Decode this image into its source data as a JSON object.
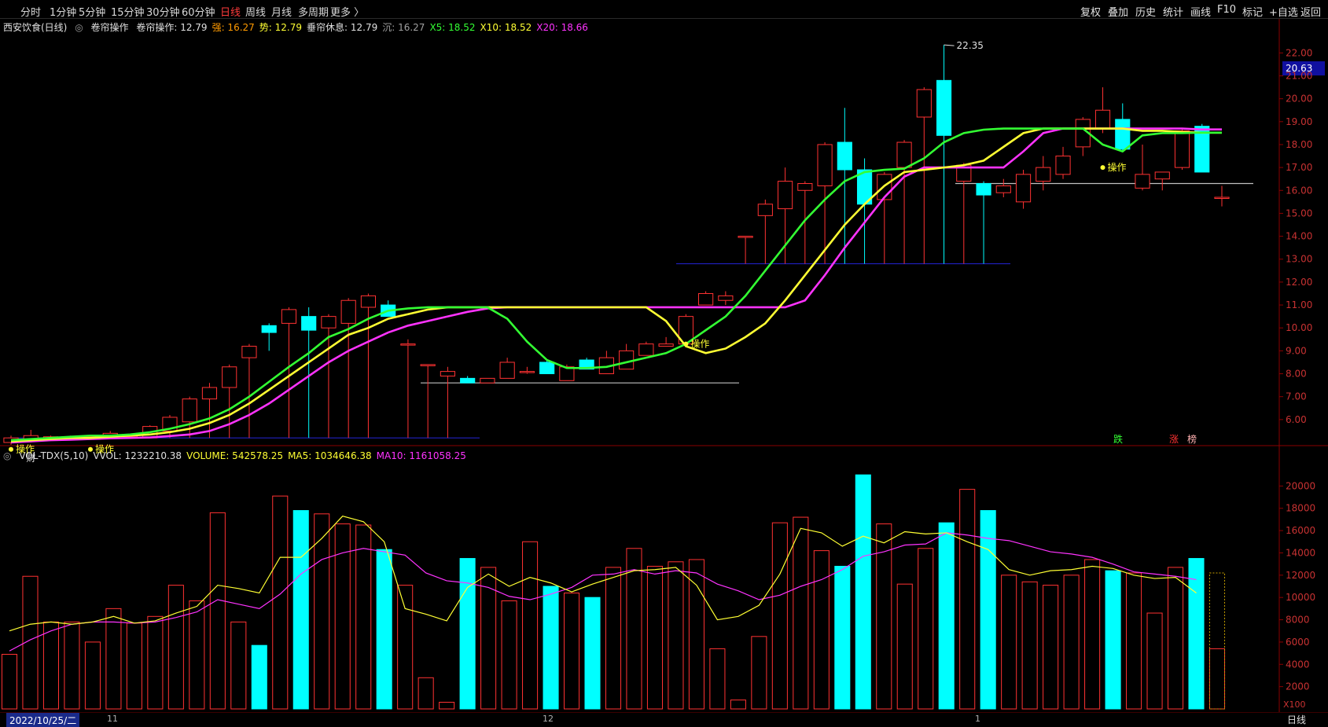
{
  "toolbar": {
    "left": [
      "分时",
      "1分钟",
      "5分钟",
      "15分钟",
      "30分钟",
      "60分钟",
      "日线",
      "周线",
      "月线",
      "多周期",
      "更多 〉"
    ],
    "active": "日线",
    "right": [
      "复权",
      "叠加",
      "历史",
      "统计",
      "画线",
      "F10",
      "标记",
      "+自选",
      "返回"
    ]
  },
  "indicator_bar": {
    "stock": "西安饮食(日线)",
    "indicator_icon": "circle-icon",
    "name": "卷帘操作",
    "items": [
      {
        "label": "卷帘操作: 12.79",
        "color": "#e0e0e0"
      },
      {
        "label": "强: 16.27",
        "color": "#ff9a00"
      },
      {
        "label": "势: 12.79",
        "color": "#ffff33"
      },
      {
        "label": "垂帘休息: 12.79",
        "color": "#e0e0e0"
      },
      {
        "label": "沉: 16.27",
        "color": "#a0a0a0"
      },
      {
        "label": "X5: 18.52",
        "color": "#33ff33"
      },
      {
        "label": "X10: 18.52",
        "color": "#ffff33"
      },
      {
        "label": "X20: 18.66",
        "color": "#ff33ff"
      }
    ]
  },
  "volume_bar": {
    "indicator_icon": "circle-icon",
    "items": [
      {
        "label": "VOL-TDX(5,10)",
        "color": "#e0e0e0"
      },
      {
        "label": "VVOL: 1232210.38",
        "color": "#e0e0e0"
      },
      {
        "label": "VOLUME: 542578.25",
        "color": "#ffff33"
      },
      {
        "label": "MA5: 1034646.38",
        "color": "#ffff33"
      },
      {
        "label": "MA10: 1161058.25",
        "color": "#ff33ff"
      }
    ]
  },
  "current_price": "20.63",
  "high_label": "22.35",
  "annotations": {
    "op": "操作",
    "cai": "财",
    "die": "跌",
    "zhang": "涨",
    "bang": "榜"
  },
  "bottom": {
    "date": "2022/10/25/二",
    "months": [
      "11",
      "12",
      "1"
    ],
    "period": "日线",
    "unit": "X100"
  },
  "colors": {
    "up": "#ff3232",
    "down": "#00ffff",
    "x5": "#33ff33",
    "x10": "#ffff33",
    "x20": "#ff33ff",
    "axis": "#8a0000"
  },
  "chart_data": [
    {
      "type": "candlestick",
      "title": "西安饮食(日线)",
      "ylim": [
        5.0,
        22.8
      ],
      "yticks": [
        "6.00",
        "7.00",
        "8.00",
        "9.00",
        "10.00",
        "11.00",
        "12.00",
        "13.00",
        "14.00",
        "15.00",
        "16.00",
        "17.00",
        "18.00",
        "19.00",
        "20.00",
        "21.00",
        "22.00"
      ],
      "candles": [
        {
          "o": 5.0,
          "c": 5.2,
          "h": 5.3,
          "l": 4.9
        },
        {
          "o": 5.15,
          "c": 5.3,
          "h": 5.55,
          "l": 5.0
        },
        {
          "o": 5.2,
          "c": 5.25,
          "h": 5.3,
          "l": 5.15
        },
        {
          "o": 5.2,
          "c": 5.25,
          "h": 5.3,
          "l": 5.1
        },
        {
          "o": 5.2,
          "c": 5.25,
          "h": 5.3,
          "l": 5.15
        },
        {
          "o": 5.2,
          "c": 5.4,
          "h": 5.5,
          "l": 5.2
        },
        {
          "o": 5.25,
          "c": 5.3,
          "h": 5.35,
          "l": 5.2
        },
        {
          "o": 5.2,
          "c": 5.7,
          "h": 5.75,
          "l": 5.2
        },
        {
          "o": 5.5,
          "c": 6.1,
          "h": 6.2,
          "l": 5.2
        },
        {
          "o": 5.9,
          "c": 6.9,
          "h": 7.0,
          "l": 5.2
        },
        {
          "o": 6.9,
          "c": 7.4,
          "h": 7.6,
          "l": 5.2
        },
        {
          "o": 7.4,
          "c": 8.3,
          "h": 8.4,
          "l": 5.2
        },
        {
          "o": 8.7,
          "c": 9.2,
          "h": 9.3,
          "l": 5.2
        },
        {
          "o": 10.1,
          "c": 9.8,
          "h": 10.2,
          "l": 9.0
        },
        {
          "o": 10.2,
          "c": 10.8,
          "h": 10.9,
          "l": 5.2
        },
        {
          "o": 10.5,
          "c": 9.9,
          "h": 10.9,
          "l": 5.2
        },
        {
          "o": 10.0,
          "c": 10.5,
          "h": 10.6,
          "l": 5.2
        },
        {
          "o": 10.2,
          "c": 11.2,
          "h": 11.3,
          "l": 5.2
        },
        {
          "o": 10.9,
          "c": 11.4,
          "h": 11.5,
          "l": 5.2
        },
        {
          "o": 11.0,
          "c": 10.5,
          "h": 11.2,
          "l": 10.5
        },
        {
          "o": 9.3,
          "c": 9.3,
          "h": 9.5,
          "l": 5.2
        },
        {
          "o": 8.4,
          "c": 8.4,
          "h": 8.4,
          "l": 5.2
        },
        {
          "o": 7.9,
          "c": 8.1,
          "h": 8.3,
          "l": 5.2
        },
        {
          "o": 7.8,
          "c": 7.6,
          "h": 7.9,
          "l": 7.6
        },
        {
          "o": 7.6,
          "c": 7.8,
          "h": 7.8,
          "l": 7.6
        },
        {
          "o": 7.8,
          "c": 8.5,
          "h": 8.7,
          "l": 7.8
        },
        {
          "o": 8.1,
          "c": 8.1,
          "h": 8.3,
          "l": 8.0
        },
        {
          "o": 8.5,
          "c": 8.0,
          "h": 8.6,
          "l": 8.0
        },
        {
          "o": 7.7,
          "c": 8.3,
          "h": 8.4,
          "l": 7.7
        },
        {
          "o": 8.6,
          "c": 8.2,
          "h": 8.7,
          "l": 8.2
        },
        {
          "o": 8.0,
          "c": 8.7,
          "h": 9.0,
          "l": 8.0
        },
        {
          "o": 8.2,
          "c": 9.0,
          "h": 9.3,
          "l": 8.2
        },
        {
          "o": 8.8,
          "c": 9.3,
          "h": 9.4,
          "l": 8.8
        },
        {
          "o": 9.2,
          "c": 9.3,
          "h": 9.6,
          "l": 9.2
        },
        {
          "o": 9.3,
          "c": 10.5,
          "h": 10.6,
          "l": 9.3
        },
        {
          "o": 11.0,
          "c": 11.5,
          "h": 11.6,
          "l": 11.0
        },
        {
          "o": 11.2,
          "c": 11.4,
          "h": 11.6,
          "l": 11.0
        },
        {
          "o": 14.0,
          "c": 14.0,
          "h": 14.0,
          "l": 12.8
        },
        {
          "o": 14.9,
          "c": 15.4,
          "h": 15.6,
          "l": 12.8
        },
        {
          "o": 15.2,
          "c": 16.4,
          "h": 17.0,
          "l": 12.8
        },
        {
          "o": 16.0,
          "c": 16.3,
          "h": 16.4,
          "l": 12.8
        },
        {
          "o": 16.2,
          "c": 18.0,
          "h": 18.1,
          "l": 12.8
        },
        {
          "o": 18.1,
          "c": 16.9,
          "h": 19.6,
          "l": 12.8
        },
        {
          "o": 16.9,
          "c": 15.4,
          "h": 17.4,
          "l": 12.8
        },
        {
          "o": 15.6,
          "c": 16.7,
          "h": 16.8,
          "l": 12.8
        },
        {
          "o": 17.0,
          "c": 18.1,
          "h": 18.2,
          "l": 12.8
        },
        {
          "o": 19.2,
          "c": 20.4,
          "h": 20.5,
          "l": 12.8
        },
        {
          "o": 20.8,
          "c": 18.4,
          "h": 22.35,
          "l": 12.8
        },
        {
          "o": 16.4,
          "c": 17.1,
          "h": 17.2,
          "l": 12.8
        },
        {
          "o": 16.3,
          "c": 15.8,
          "h": 16.4,
          "l": 12.8
        },
        {
          "o": 15.9,
          "c": 16.2,
          "h": 16.5,
          "l": 15.7
        },
        {
          "o": 15.5,
          "c": 16.7,
          "h": 16.9,
          "l": 15.2
        },
        {
          "o": 16.4,
          "c": 17.0,
          "h": 17.5,
          "l": 16.0
        },
        {
          "o": 16.7,
          "c": 17.5,
          "h": 17.9,
          "l": 16.5
        },
        {
          "o": 17.9,
          "c": 19.1,
          "h": 19.2,
          "l": 17.5
        },
        {
          "o": 18.7,
          "c": 19.5,
          "h": 20.5,
          "l": 18.5
        },
        {
          "o": 19.1,
          "c": 17.8,
          "h": 19.8,
          "l": 17.7
        },
        {
          "o": 16.1,
          "c": 16.7,
          "h": 18.0,
          "l": 16.0
        },
        {
          "o": 16.5,
          "c": 16.8,
          "h": 16.8,
          "l": 16.0
        },
        {
          "o": 17.0,
          "c": 18.6,
          "h": 18.7,
          "l": 16.9
        },
        {
          "o": 18.8,
          "c": 16.8,
          "h": 18.9,
          "l": 16.8
        },
        {
          "o": 15.7,
          "c": 15.7,
          "h": 16.2,
          "l": 15.3
        }
      ],
      "x5": [
        5.1,
        5.15,
        5.2,
        5.25,
        5.3,
        5.3,
        5.35,
        5.45,
        5.6,
        5.8,
        6.05,
        6.45,
        7.0,
        7.65,
        8.3,
        8.9,
        9.6,
        9.95,
        10.4,
        10.75,
        10.85,
        10.9,
        10.9,
        10.9,
        10.9,
        10.4,
        9.4,
        8.6,
        8.25,
        8.25,
        8.3,
        8.5,
        8.7,
        8.9,
        9.3,
        9.9,
        10.5,
        11.4,
        12.5,
        13.6,
        14.7,
        15.6,
        16.4,
        16.8,
        16.9,
        16.95,
        17.4,
        18.1,
        18.5,
        18.65,
        18.7,
        18.7,
        18.7,
        18.7,
        18.7,
        18.0,
        17.7,
        18.4,
        18.5,
        18.5,
        18.52,
        18.52
      ],
      "x10": [
        5.05,
        5.1,
        5.15,
        5.2,
        5.2,
        5.25,
        5.3,
        5.35,
        5.45,
        5.6,
        5.85,
        6.2,
        6.7,
        7.3,
        7.9,
        8.5,
        9.1,
        9.7,
        10.0,
        10.4,
        10.6,
        10.8,
        10.9,
        10.9,
        10.9,
        10.9,
        10.9,
        10.9,
        10.9,
        10.9,
        10.9,
        10.9,
        10.9,
        10.3,
        9.2,
        8.9,
        9.1,
        9.6,
        10.2,
        11.2,
        12.3,
        13.4,
        14.5,
        15.4,
        16.2,
        16.8,
        16.9,
        17.0,
        17.1,
        17.3,
        17.9,
        18.5,
        18.7,
        18.7,
        18.7,
        18.7,
        18.7,
        18.6,
        18.6,
        18.55,
        18.52,
        18.52
      ],
      "x20": [
        5.0,
        5.05,
        5.1,
        5.12,
        5.15,
        5.18,
        5.2,
        5.22,
        5.28,
        5.35,
        5.5,
        5.8,
        6.2,
        6.7,
        7.3,
        7.9,
        8.5,
        9.0,
        9.4,
        9.8,
        10.1,
        10.3,
        10.5,
        10.7,
        10.85,
        10.9,
        10.9,
        10.9,
        10.9,
        10.9,
        10.9,
        10.9,
        10.9,
        10.9,
        10.9,
        10.9,
        10.9,
        10.9,
        10.9,
        10.9,
        11.2,
        12.3,
        13.5,
        14.6,
        15.7,
        16.6,
        17.0,
        17.0,
        17.0,
        17.0,
        17.0,
        17.7,
        18.5,
        18.7,
        18.7,
        18.7,
        18.7,
        18.7,
        18.7,
        18.7,
        18.66,
        18.66
      ],
      "levels": [
        {
          "y": 16.3,
          "color": "#c0c0c0"
        },
        {
          "y": 7.6,
          "color": "#c0c0c0"
        },
        {
          "y": 12.8,
          "color": "#2020c0"
        },
        {
          "y": 5.2,
          "color": "#2020c0"
        }
      ]
    },
    {
      "type": "bar",
      "title": "VOL-TDX(5,10)",
      "ylim": [
        0,
        22000
      ],
      "yticks": [
        "2000",
        "4000",
        "6000",
        "8000",
        "10000",
        "12000",
        "14000",
        "16000",
        "18000",
        "20000"
      ],
      "volumes": [
        4900,
        11900,
        7800,
        7800,
        6000,
        9000,
        7700,
        8300,
        11100,
        9700,
        17600,
        7800,
        5700,
        19100,
        17800,
        17500,
        16600,
        16500,
        14300,
        11100,
        2800,
        600,
        13500,
        12700,
        9700,
        15000,
        11000,
        10400,
        10000,
        12700,
        14400,
        12800,
        13200,
        13400,
        5400,
        800,
        6500,
        16700,
        17200,
        14200,
        12800,
        21000,
        16600,
        11200,
        14400,
        16700,
        19700,
        17800,
        12000,
        11400,
        11100,
        12000,
        13400,
        12400,
        12200,
        8600,
        12700,
        13500,
        5400
      ],
      "ma5": [
        7000,
        7600,
        7800,
        7600,
        7800,
        8300,
        7700,
        7900,
        8600,
        9200,
        11100,
        10800,
        10400,
        13600,
        13600,
        15300,
        17300,
        16800,
        15000,
        9000,
        8500,
        7900,
        10900,
        12100,
        11000,
        11800,
        11300,
        10500,
        11200,
        11800,
        12400,
        12500,
        12700,
        11100,
        8000,
        8300,
        9300,
        12100,
        16200,
        15800,
        14600,
        15500,
        14900,
        15900,
        15700,
        15800,
        15000,
        14300,
        12500,
        12000,
        12400,
        12500,
        12800,
        12600,
        12000,
        11700,
        11800,
        10400
      ],
      "ma10": [
        5200,
        6200,
        7000,
        7600,
        7800,
        7800,
        7700,
        7800,
        8200,
        8700,
        9800,
        9400,
        9000,
        10300,
        12100,
        13400,
        14000,
        14400,
        14100,
        13800,
        12200,
        11500,
        11300,
        10900,
        10100,
        9800,
        10300,
        10900,
        12000,
        12100,
        12500,
        12100,
        12400,
        12200,
        11200,
        10600,
        9800,
        10200,
        11000,
        11600,
        12500,
        13700,
        14100,
        14700,
        14800,
        15800,
        15600,
        15300,
        15100,
        14600,
        14100,
        13900,
        13600,
        13000,
        12300,
        12100,
        11900,
        11600
      ]
    }
  ]
}
